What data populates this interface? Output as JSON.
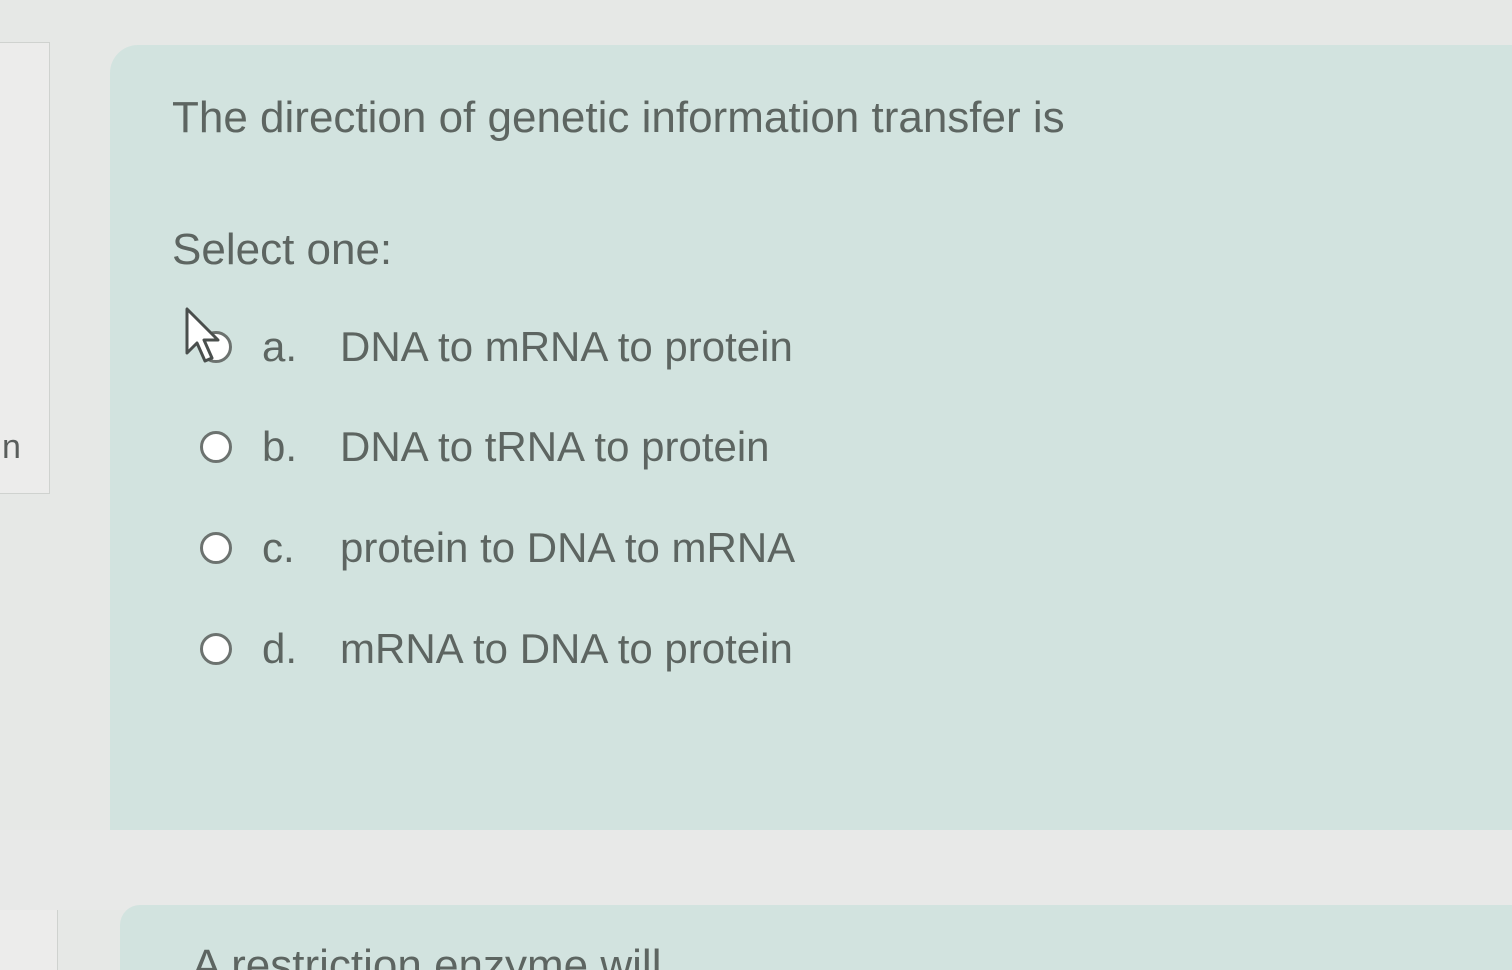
{
  "sidebar": {
    "fragment_text": "n"
  },
  "question": {
    "text": "The direction of genetic information transfer is",
    "prompt": "Select one:",
    "options": [
      {
        "letter": "a.",
        "text": "DNA to mRNA to protein"
      },
      {
        "letter": "b.",
        "text": "DNA to tRNA to protein"
      },
      {
        "letter": "c.",
        "text": "protein to DNA to mRNA"
      },
      {
        "letter": "d.",
        "text": "mRNA to DNA to protein"
      }
    ]
  },
  "next_question": {
    "text": "A restriction enzyme will"
  },
  "colors": {
    "question_background": "#d2e3df",
    "text": "#5d6561"
  }
}
